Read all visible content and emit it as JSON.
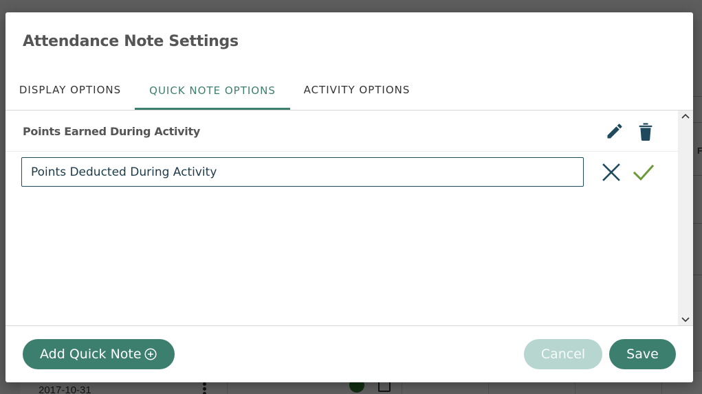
{
  "background": {
    "row_date": "2017-10-31",
    "right_edge_letter": "F"
  },
  "modal": {
    "title": "Attendance Note Settings",
    "tabs": [
      {
        "label": "DISPLAY OPTIONS",
        "active": false
      },
      {
        "label": "QUICK NOTE OPTIONS",
        "active": true
      },
      {
        "label": "ACTIVITY OPTIONS",
        "active": false
      }
    ],
    "quick_notes": [
      {
        "label": "Points Earned During Activity",
        "actions": [
          "pencil-icon",
          "trash-icon"
        ]
      }
    ],
    "editing_note": {
      "value": "Points Deducted During Activity",
      "actions": [
        "close-icon",
        "check-icon"
      ]
    },
    "footer": {
      "add_label": "Add Quick Note",
      "add_icon": "plus-circle-icon",
      "cancel_label": "Cancel",
      "save_label": "Save"
    }
  },
  "colors": {
    "accent": "#3d7f6e",
    "accent_disabled": "#b7d6cf",
    "icon_dark": "#1f4a5e",
    "check_green": "#6b9a3a",
    "title_gray": "#555555"
  }
}
